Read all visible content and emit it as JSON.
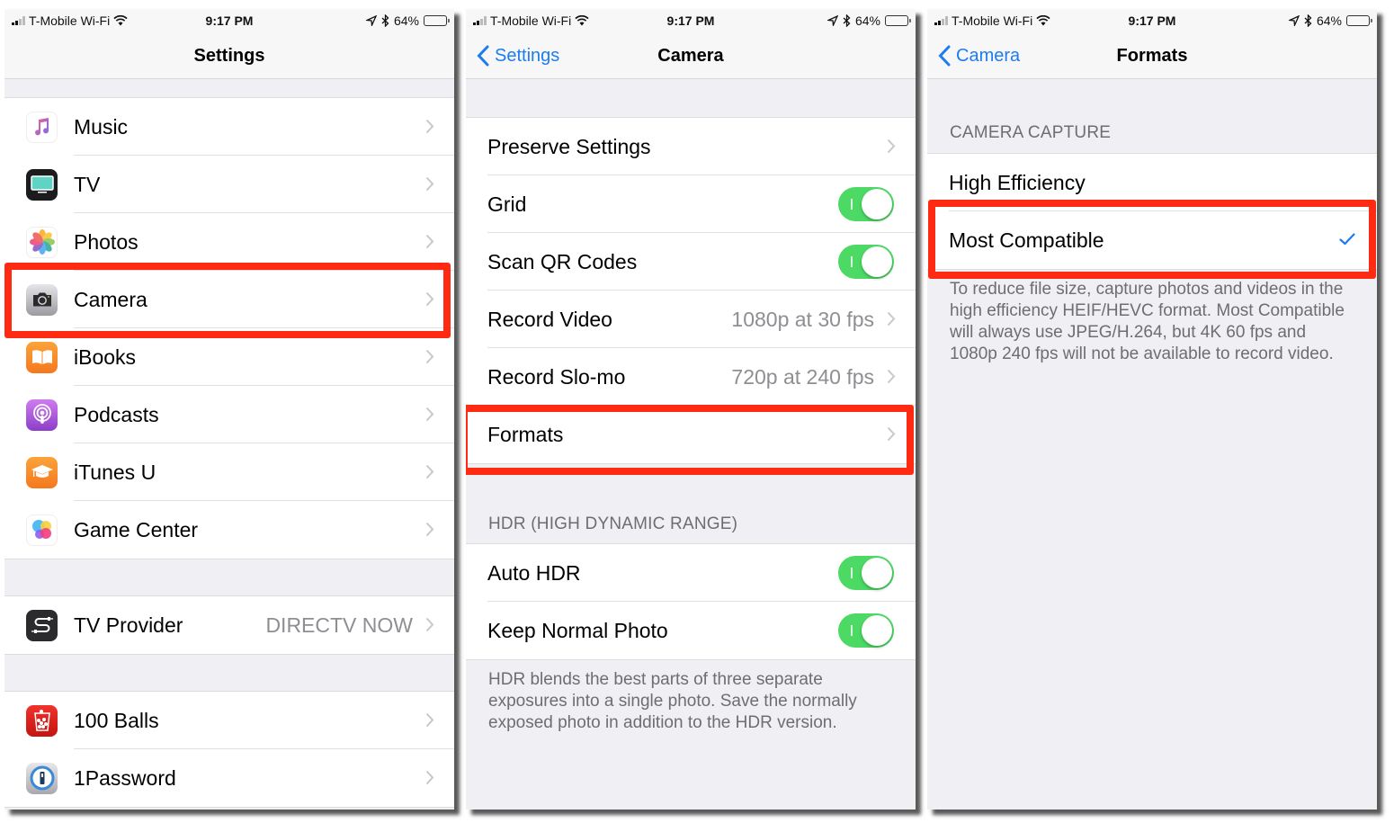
{
  "status_bar": {
    "carrier": "T-Mobile Wi-Fi",
    "time": "9:17 PM",
    "battery_percent": "64%",
    "battery_level": 0.64,
    "icons": [
      "signal-icon",
      "wifi-icon",
      "location-arrow-icon",
      "bluetooth-icon",
      "battery-icon"
    ]
  },
  "colors": {
    "accent": "#1c7cf0",
    "toggle_on": "#4cd964",
    "highlight": "#ff2a12",
    "group_background": "#efeff4",
    "secondary_text": "#8e8e93"
  },
  "panels": {
    "settings": {
      "title": "Settings",
      "groups": [
        {
          "items": [
            {
              "label": "Music",
              "icon": "music-icon",
              "chevron": true
            },
            {
              "label": "TV",
              "icon": "tv-icon",
              "chevron": true
            },
            {
              "label": "Photos",
              "icon": "photos-icon",
              "chevron": true
            },
            {
              "label": "Camera",
              "icon": "camera-icon",
              "chevron": true,
              "highlighted": true
            },
            {
              "label": "iBooks",
              "icon": "ibooks-icon",
              "chevron": true
            },
            {
              "label": "Podcasts",
              "icon": "podcasts-icon",
              "chevron": true
            },
            {
              "label": "iTunes U",
              "icon": "itunes-u-icon",
              "chevron": true
            },
            {
              "label": "Game Center",
              "icon": "game-center-icon",
              "chevron": true
            }
          ]
        },
        {
          "items": [
            {
              "label": "TV Provider",
              "value": "DIRECTV NOW",
              "icon": "tv-provider-icon",
              "chevron": true
            }
          ]
        },
        {
          "items": [
            {
              "label": "100 Balls",
              "icon": "100-balls-icon",
              "chevron": true
            },
            {
              "label": "1Password",
              "icon": "1password-icon",
              "chevron": true
            }
          ]
        }
      ]
    },
    "camera": {
      "back_label": "Settings",
      "title": "Camera",
      "group1": [
        {
          "label": "Preserve Settings",
          "type": "link"
        },
        {
          "label": "Grid",
          "type": "toggle",
          "on": true
        },
        {
          "label": "Scan QR Codes",
          "type": "toggle",
          "on": true
        },
        {
          "label": "Record Video",
          "type": "link",
          "value": "1080p at 30 fps"
        },
        {
          "label": "Record Slo-mo",
          "type": "link",
          "value": "720p at 240 fps"
        },
        {
          "label": "Formats",
          "type": "link",
          "highlighted": true
        }
      ],
      "hdr_header": "HDR (HIGH DYNAMIC RANGE)",
      "group2": [
        {
          "label": "Auto HDR",
          "type": "toggle",
          "on": true
        },
        {
          "label": "Keep Normal Photo",
          "type": "toggle",
          "on": true
        }
      ],
      "hdr_footnote": "HDR blends the best parts of three separate exposures into a single photo. Save the normally exposed photo in addition to the HDR version."
    },
    "formats": {
      "back_label": "Camera",
      "title": "Formats",
      "section_header": "CAMERA CAPTURE",
      "options": [
        {
          "label": "High Efficiency",
          "selected": false
        },
        {
          "label": "Most Compatible",
          "selected": true,
          "highlighted": true
        }
      ],
      "footnote": "To reduce file size, capture photos and videos in the high efficiency HEIF/HEVC format. Most Compatible will always use JPEG/H.264, but 4K 60 fps and 1080p 240 fps will not be available to record video."
    }
  }
}
